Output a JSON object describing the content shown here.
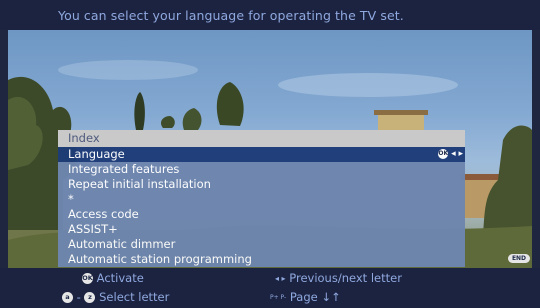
{
  "header": {
    "text": "You can select your language for operating the TV set."
  },
  "menu": {
    "title": "Index",
    "items": [
      {
        "label": "Language"
      },
      {
        "label": "Integrated features"
      },
      {
        "label": "Repeat initial installation"
      },
      {
        "label": "*"
      },
      {
        "label": "Access code"
      },
      {
        "label": "ASSIST+"
      },
      {
        "label": "Automatic dimmer"
      },
      {
        "label": "Automatic station programming"
      }
    ],
    "selected_index": 0,
    "ok_badge": "OK",
    "selected_hint_arrows": "◂ ▸"
  },
  "footer": {
    "ok_badge": "OK",
    "activate_label": "Activate",
    "a_badge": "a",
    "z_badge": "z",
    "select_letter_label": "Select letter",
    "prev_next_arrows": "◂ ▸",
    "prev_next_label": "Previous/next letter",
    "page_key": "P+ P-",
    "page_label": "Page ↓↑",
    "end_badge": "END"
  },
  "colors": {
    "bar_bg": "#1c2341",
    "hint_text": "#8fa8de",
    "menu_bg": "#6e86ae",
    "selected_bg": "#1e3d78",
    "title_bg": "#c9c9c9"
  }
}
